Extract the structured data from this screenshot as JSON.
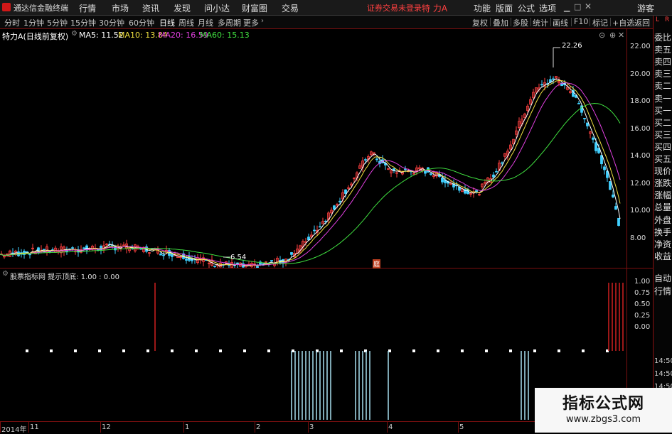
{
  "titlebar": {
    "app_name": "通达信金融终端",
    "menus": [
      "行情",
      "市场",
      "资讯",
      "发现",
      "问小达",
      "财富圈",
      "交易"
    ],
    "login_notice": "证券交易未登录",
    "stock_title": "特 力A",
    "right_menus": [
      "功能",
      "版面",
      "公式",
      "选项"
    ],
    "guest": "游客"
  },
  "periodbar": {
    "periods": [
      "分时",
      "1分钟",
      "5分钟",
      "15分钟",
      "30分钟",
      "60分钟",
      "日线",
      "周线",
      "月线",
      "多周期",
      "更多"
    ],
    "active": "日线",
    "right_buttons": [
      "复权",
      "叠加",
      "多股",
      "统计",
      "画线",
      "F10",
      "标记",
      "+自选",
      "返回"
    ],
    "right_letters": [
      "L",
      "R"
    ]
  },
  "main_chart": {
    "title": "特力A(日线前复权)",
    "ma": [
      {
        "label": "MA5: 11.52",
        "color": "#ffffff"
      },
      {
        "label": "MA10: 13.84",
        "color": "#f0e040"
      },
      {
        "label": "MA20: 16.59",
        "color": "#e040e0"
      },
      {
        "label": "MA60: 15.13",
        "color": "#40e040"
      }
    ],
    "y_ticks": [
      "22.00",
      "20.00",
      "18.00",
      "16.00",
      "14.00",
      "12.00",
      "10.00",
      "8.00"
    ],
    "high_label": "22.26",
    "low_label": "6.54",
    "marker": "庭"
  },
  "right_panel_items": [
    "委比",
    "卖五",
    "卖四",
    "卖三",
    "卖二",
    "卖一",
    "买一",
    "买二",
    "买三",
    "买四",
    "买五",
    "现价",
    "涨跌",
    "涨幅",
    "总量",
    "外盘",
    "换手",
    "净资",
    "收益",
    "自动",
    "行情"
  ],
  "indicator": {
    "title": "股票指标网 提示顶底: 1.00 : 0.00",
    "y_ticks": [
      "1.00",
      "0.75",
      "0.50",
      "0.25",
      "0.00"
    ],
    "time_ticks": [
      "14:50",
      "14:50",
      "14:50",
      "14:50",
      "14:50"
    ]
  },
  "x_axis": [
    "2014年",
    "11",
    "12",
    "1",
    "2",
    "3",
    "4",
    "5"
  ],
  "watermark": {
    "line1": "指标公式网",
    "line2": "www.zbgs3.com"
  },
  "colors": {
    "up": "#ff4040",
    "down": "#40d0ff",
    "ma5": "#ffffff",
    "ma10": "#f0e040",
    "ma20": "#e040e0",
    "ma60": "#40e040",
    "grid": "#7a0f0f"
  }
}
